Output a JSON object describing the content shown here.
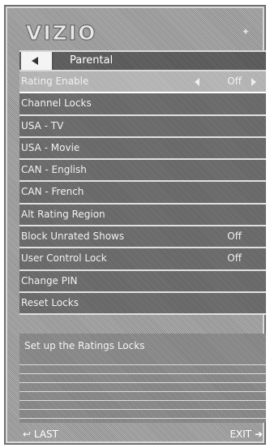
{
  "brand": "VIZIO",
  "header": {
    "title": "Parental"
  },
  "menu": [
    {
      "label": "Rating Enable",
      "value": "Off",
      "selected": true
    },
    {
      "label": "Channel Locks",
      "value": ""
    },
    {
      "label": "USA - TV",
      "value": ""
    },
    {
      "label": "USA - Movie",
      "value": ""
    },
    {
      "label": "CAN - English",
      "value": ""
    },
    {
      "label": "CAN - French",
      "value": ""
    },
    {
      "label": "Alt Rating Region",
      "value": ""
    },
    {
      "label": "Block Unrated Shows",
      "value": "Off"
    },
    {
      "label": "User Control Lock",
      "value": "Off"
    },
    {
      "label": "Change PIN",
      "value": ""
    },
    {
      "label": "Reset Locks",
      "value": ""
    }
  ],
  "help": {
    "text": "Set up the Ratings Locks"
  },
  "footer": {
    "last_label": "LAST",
    "exit_label": "EXIT"
  },
  "icons": {
    "back": "chevron-left-icon",
    "last": "return-arrow-icon",
    "exit": "exit-arrow-icon",
    "corner": "star-icon"
  }
}
